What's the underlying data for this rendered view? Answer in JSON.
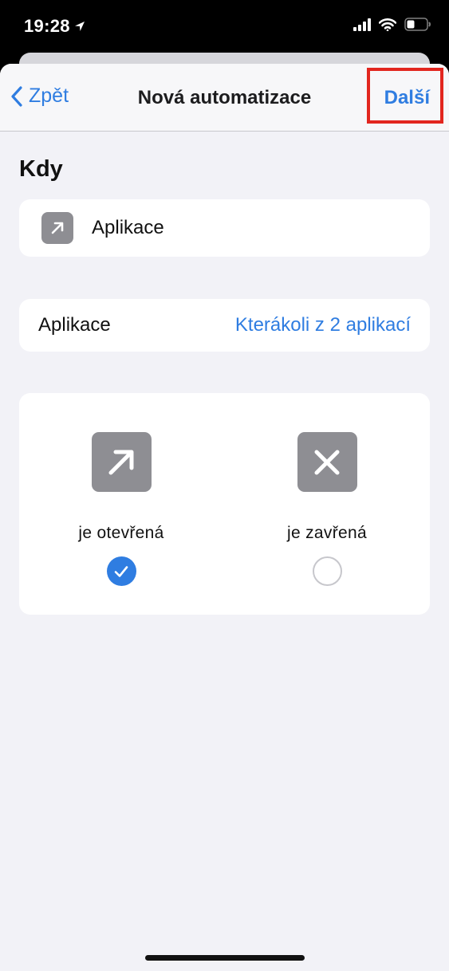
{
  "status": {
    "time": "19:28"
  },
  "nav": {
    "back_label": "Zpět",
    "title": "Nová automatizace",
    "next_label": "Další",
    "highlight_color": "#e2261f"
  },
  "section": {
    "title": "Kdy"
  },
  "trigger": {
    "label": "Aplikace",
    "icon": "arrow-up-right-icon"
  },
  "apps_row": {
    "label": "Aplikace",
    "value": "Kterákoli z 2 aplikací"
  },
  "options": [
    {
      "label": "je otevřená",
      "icon": "arrow-up-right-icon",
      "selected": true
    },
    {
      "label": "je zavřená",
      "icon": "x-icon",
      "selected": false
    }
  ],
  "colors": {
    "accent": "#2f7de1",
    "icon_bg": "#8e8e93",
    "background": "#f2f2f7"
  }
}
